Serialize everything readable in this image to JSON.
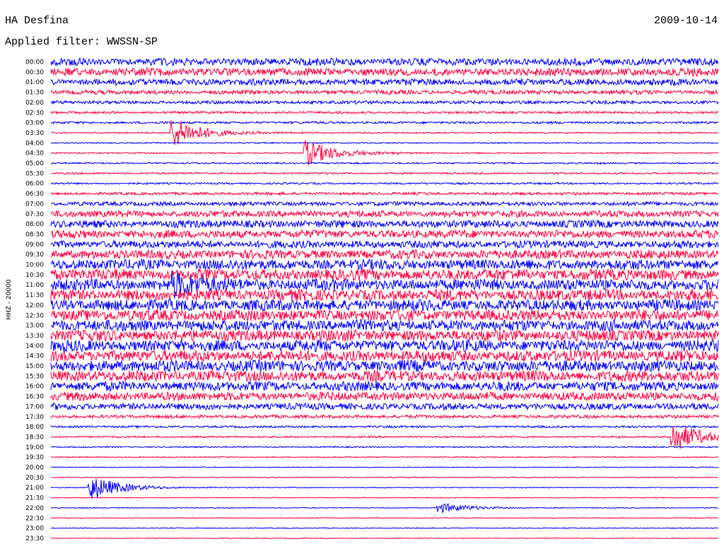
{
  "header": {
    "station": "HA Desfina",
    "date": "2009-10-14",
    "filter_label": "Applied filter:",
    "filter_name": "WWSSN-SP"
  },
  "chart_data": {
    "type": "helicorder",
    "title": "HA Desfina",
    "date": "2009-10-14",
    "filter": "WWSSN-SP",
    "ylabel": "HHZ - 20000",
    "row_interval_minutes": 30,
    "colors": [
      "#0000ff",
      "#ff0040"
    ],
    "rows": [
      {
        "label": "00:00",
        "amp": 1.6
      },
      {
        "label": "00:30",
        "amp": 1.7
      },
      {
        "label": "01:00",
        "amp": 1.4
      },
      {
        "label": "01:30",
        "amp": 0.9
      },
      {
        "label": "02:00",
        "amp": 0.7
      },
      {
        "label": "02:30",
        "amp": 0.5
      },
      {
        "label": "03:00",
        "amp": 0.5
      },
      {
        "label": "03:30",
        "amp": 0.3
      },
      {
        "label": "04:00",
        "amp": 0.25
      },
      {
        "label": "04:30",
        "amp": 0.3
      },
      {
        "label": "05:00",
        "amp": 0.35
      },
      {
        "label": "05:30",
        "amp": 0.4
      },
      {
        "label": "06:00",
        "amp": 0.4
      },
      {
        "label": "06:30",
        "amp": 0.6
      },
      {
        "label": "07:00",
        "amp": 0.9
      },
      {
        "label": "07:30",
        "amp": 1.4
      },
      {
        "label": "08:00",
        "amp": 1.6
      },
      {
        "label": "08:30",
        "amp": 1.7
      },
      {
        "label": "09:00",
        "amp": 1.6
      },
      {
        "label": "09:30",
        "amp": 1.9
      },
      {
        "label": "10:00",
        "amp": 2.2
      },
      {
        "label": "10:30",
        "amp": 2.4
      },
      {
        "label": "11:00",
        "amp": 2.4
      },
      {
        "label": "11:30",
        "amp": 2.4
      },
      {
        "label": "12:00",
        "amp": 2.4
      },
      {
        "label": "12:30",
        "amp": 2.4
      },
      {
        "label": "13:00",
        "amp": 2.4
      },
      {
        "label": "13:30",
        "amp": 2.4
      },
      {
        "label": "14:00",
        "amp": 2.4
      },
      {
        "label": "14:30",
        "amp": 2.4
      },
      {
        "label": "15:00",
        "amp": 2.4
      },
      {
        "label": "15:30",
        "amp": 2.3
      },
      {
        "label": "16:00",
        "amp": 2.0
      },
      {
        "label": "16:30",
        "amp": 1.8
      },
      {
        "label": "17:00",
        "amp": 1.4
      },
      {
        "label": "17:30",
        "amp": 0.7
      },
      {
        "label": "18:00",
        "amp": 0.45
      },
      {
        "label": "18:30",
        "amp": 0.4
      },
      {
        "label": "19:00",
        "amp": 0.3
      },
      {
        "label": "19:30",
        "amp": 0.25
      },
      {
        "label": "20:00",
        "amp": 0.2
      },
      {
        "label": "20:30",
        "amp": 0.2
      },
      {
        "label": "21:00",
        "amp": 0.2
      },
      {
        "label": "21:30",
        "amp": 0.2
      },
      {
        "label": "22:00",
        "amp": 0.2
      },
      {
        "label": "22:30",
        "amp": 0.18
      },
      {
        "label": "23:00",
        "amp": 0.18
      },
      {
        "label": "23:30",
        "amp": 0.18
      }
    ],
    "events": [
      {
        "row": "03:30",
        "minute": 5.5,
        "amp": 6
      },
      {
        "row": "04:30",
        "minute": 11.5,
        "amp": 5
      },
      {
        "row": "11:00",
        "minute": 5.5,
        "amp": 4
      },
      {
        "row": "18:30",
        "minute": 28.0,
        "amp": 6
      },
      {
        "row": "21:00",
        "minute": 1.8,
        "amp": 5
      },
      {
        "row": "22:00",
        "minute": 17.5,
        "amp": 2
      }
    ]
  }
}
